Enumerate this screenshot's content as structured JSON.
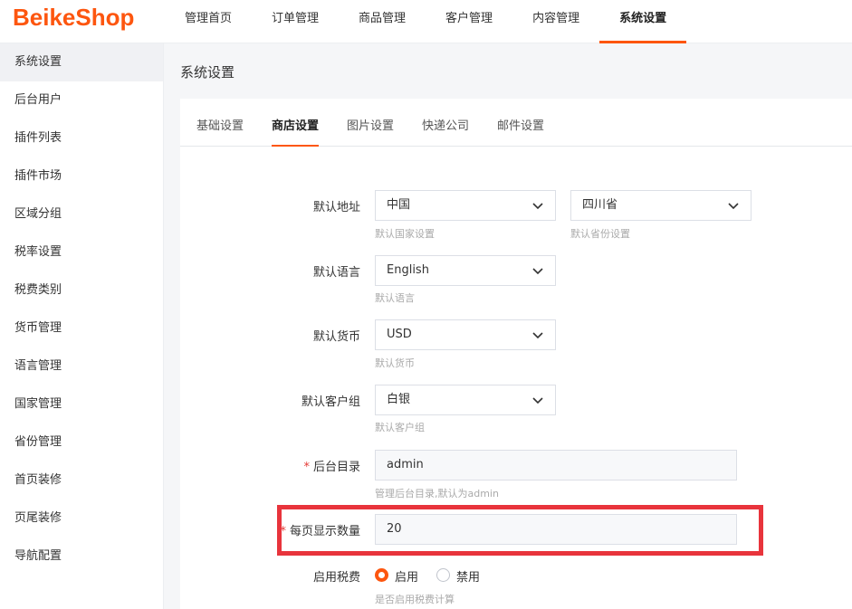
{
  "brand": {
    "logo": "BeikeShop",
    "accent": "#fd560f"
  },
  "nav": [
    {
      "label": "管理首页"
    },
    {
      "label": "订单管理"
    },
    {
      "label": "商品管理"
    },
    {
      "label": "客户管理"
    },
    {
      "label": "内容管理"
    },
    {
      "label": "系统设置",
      "active": true
    }
  ],
  "sidebar": [
    {
      "label": "系统设置",
      "active": true
    },
    {
      "label": "后台用户"
    },
    {
      "label": "插件列表"
    },
    {
      "label": "插件市场"
    },
    {
      "label": "区域分组"
    },
    {
      "label": "税率设置"
    },
    {
      "label": "税费类别"
    },
    {
      "label": "货币管理"
    },
    {
      "label": "语言管理"
    },
    {
      "label": "国家管理"
    },
    {
      "label": "省份管理"
    },
    {
      "label": "首页装修"
    },
    {
      "label": "页尾装修"
    },
    {
      "label": "导航配置"
    }
  ],
  "page_title": "系统设置",
  "tabs": [
    {
      "label": "基础设置"
    },
    {
      "label": "商店设置",
      "active": true
    },
    {
      "label": "图片设置"
    },
    {
      "label": "快递公司"
    },
    {
      "label": "邮件设置"
    }
  ],
  "form": {
    "address": {
      "label": "默认地址",
      "country": "中国",
      "country_help": "默认国家设置",
      "province": "四川省",
      "province_help": "默认省份设置"
    },
    "language": {
      "label": "默认语言",
      "value": "English",
      "help": "默认语言"
    },
    "currency": {
      "label": "默认货币",
      "value": "USD",
      "help": "默认货币"
    },
    "customer_group": {
      "label": "默认客户组",
      "value": "白银",
      "help": "默认客户组"
    },
    "admin_dir": {
      "label": "后台目录",
      "required": "*",
      "value": "admin",
      "help": "管理后台目录,默认为admin"
    },
    "per_page": {
      "label": "每页显示数量",
      "required": "*",
      "value": "20"
    },
    "tax": {
      "label": "启用税费",
      "option_on": "启用",
      "option_off": "禁用",
      "selected": "启用",
      "help": "是否启用税费计算"
    }
  },
  "highlight_color": "#e8343c"
}
